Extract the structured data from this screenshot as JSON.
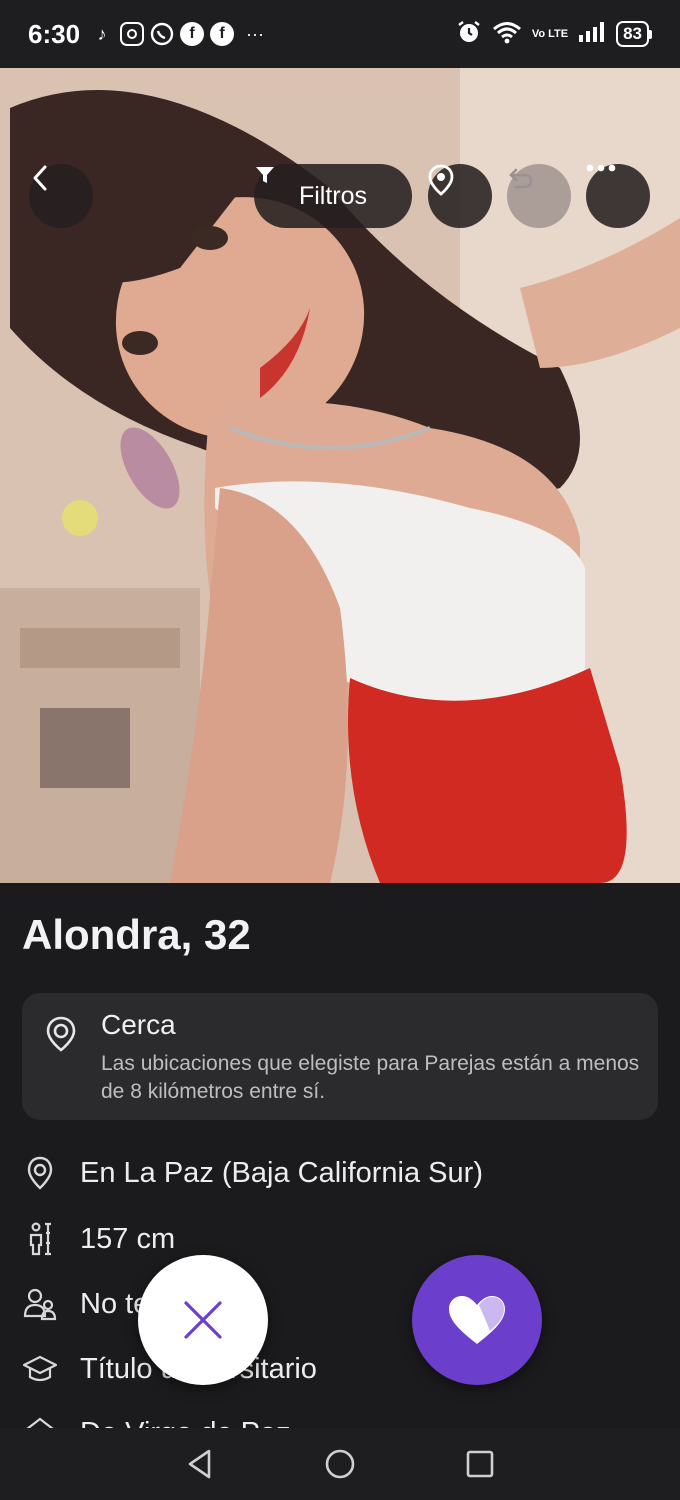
{
  "status_bar": {
    "time": "6:30",
    "notifications": [
      "tiktok-icon",
      "instagram-icon",
      "whatsapp-icon",
      "facebook-icon",
      "facebook-icon"
    ],
    "more": "···",
    "network": "Vo LTE",
    "battery": "83"
  },
  "toolbar": {
    "filters_label": "Filtros"
  },
  "profile": {
    "name": "Alondra, 32",
    "near_card": {
      "title": "Cerca",
      "description": "Las ubicaciones que elegiste para Parejas están a menos de 8 kilómetros entre sí."
    },
    "details": [
      {
        "icon": "location-pin-icon",
        "text": "En La Paz (Baja California Sur)"
      },
      {
        "icon": "height-icon",
        "text": "157 cm"
      },
      {
        "icon": "children-icon",
        "text": "No tengo hijos"
      },
      {
        "icon": "graduation-cap-icon",
        "text": "Título universitario"
      },
      {
        "icon": "sign-icon",
        "text": "De Virgo de Paz"
      }
    ]
  },
  "colors": {
    "accent": "#6b3fcc",
    "background": "#1b1b1d",
    "card": "#2b2b2e"
  }
}
